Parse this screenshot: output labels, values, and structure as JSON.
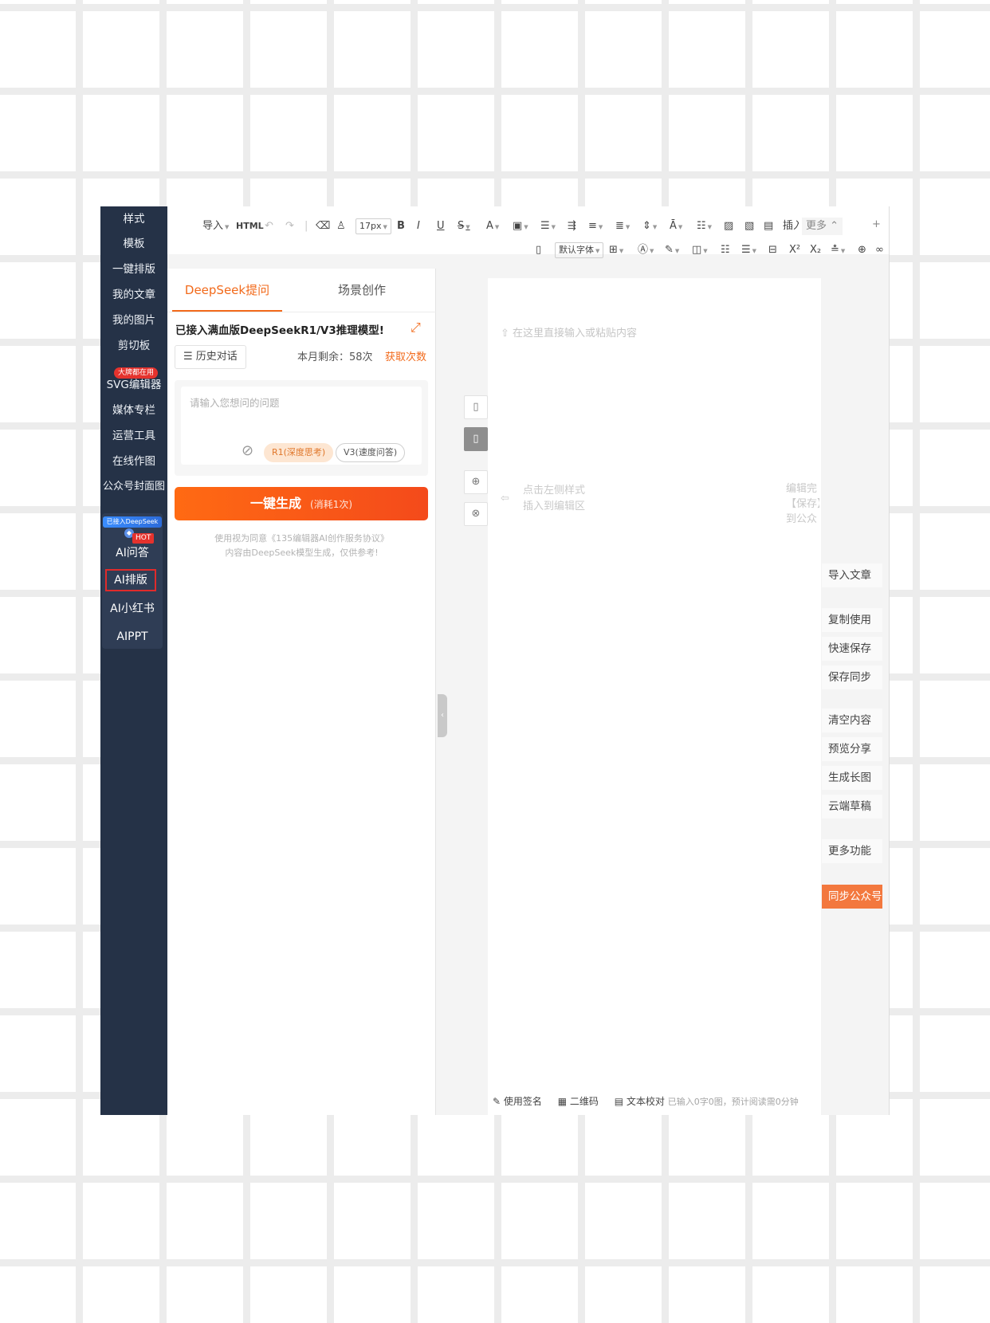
{
  "sidebar": {
    "items": [
      "样式",
      "模板",
      "一键排版",
      "我的文章",
      "我的图片",
      "剪切板",
      "SVG编辑器",
      "媒体专栏",
      "运营工具",
      "在线作图",
      "公众号封面图"
    ],
    "svg_badge": "大牌都在用",
    "ai_banner": "已接入DeepSeek",
    "hot": "HOT",
    "ai_items": [
      "AI问答",
      "AI排版",
      "AI小红书",
      "AIPPT"
    ]
  },
  "toolbar": {
    "import": "导入",
    "html": "HTML",
    "font_size": "17px",
    "font_family": "默认字体",
    "insert": "插入",
    "more": "更多"
  },
  "panel": {
    "tab_deepseek": "DeepSeek提问",
    "tab_scene": "场景创作",
    "headline": "已接入满血版DeepSeekR1/V3推理模型!",
    "history": "历史对话",
    "remaining": "本月剩余：58次",
    "get_more": "获取次数",
    "question_placeholder": "请输入您想问的问题",
    "mode_r1": "R1(深度思考)",
    "mode_v3": "V3(速度问答)",
    "generate": "一键生成",
    "generate_cost": "(消耗1次)",
    "agree_line1": "使用视为同意《135编辑器AI创作服务协议》",
    "agree_line2": "内容由DeepSeek模型生成，仅供参考!"
  },
  "editor": {
    "paste_hint": "在这里直接输入或粘贴内容",
    "style_hint_1": "点击左侧样式",
    "style_hint_2": "插入到编辑区",
    "clip_1": "编辑完",
    "clip_2": "【保存】",
    "clip_3": "到公众",
    "footer_sign": "使用签名",
    "footer_qr": "二维码",
    "footer_check": "文本校对",
    "footer_stats": "已输入0字0图，预计阅读需0分钟"
  },
  "actions": [
    "导入文章",
    "复制使用",
    "快速保存",
    "保存同步",
    "清空内容",
    "预览分享",
    "生成长图",
    "云端草稿",
    "更多功能"
  ],
  "sync_button": "同步公众号",
  "colors": {
    "accent": "#f26a1b",
    "sidebar": "#253247",
    "sync": "#f3783e"
  }
}
